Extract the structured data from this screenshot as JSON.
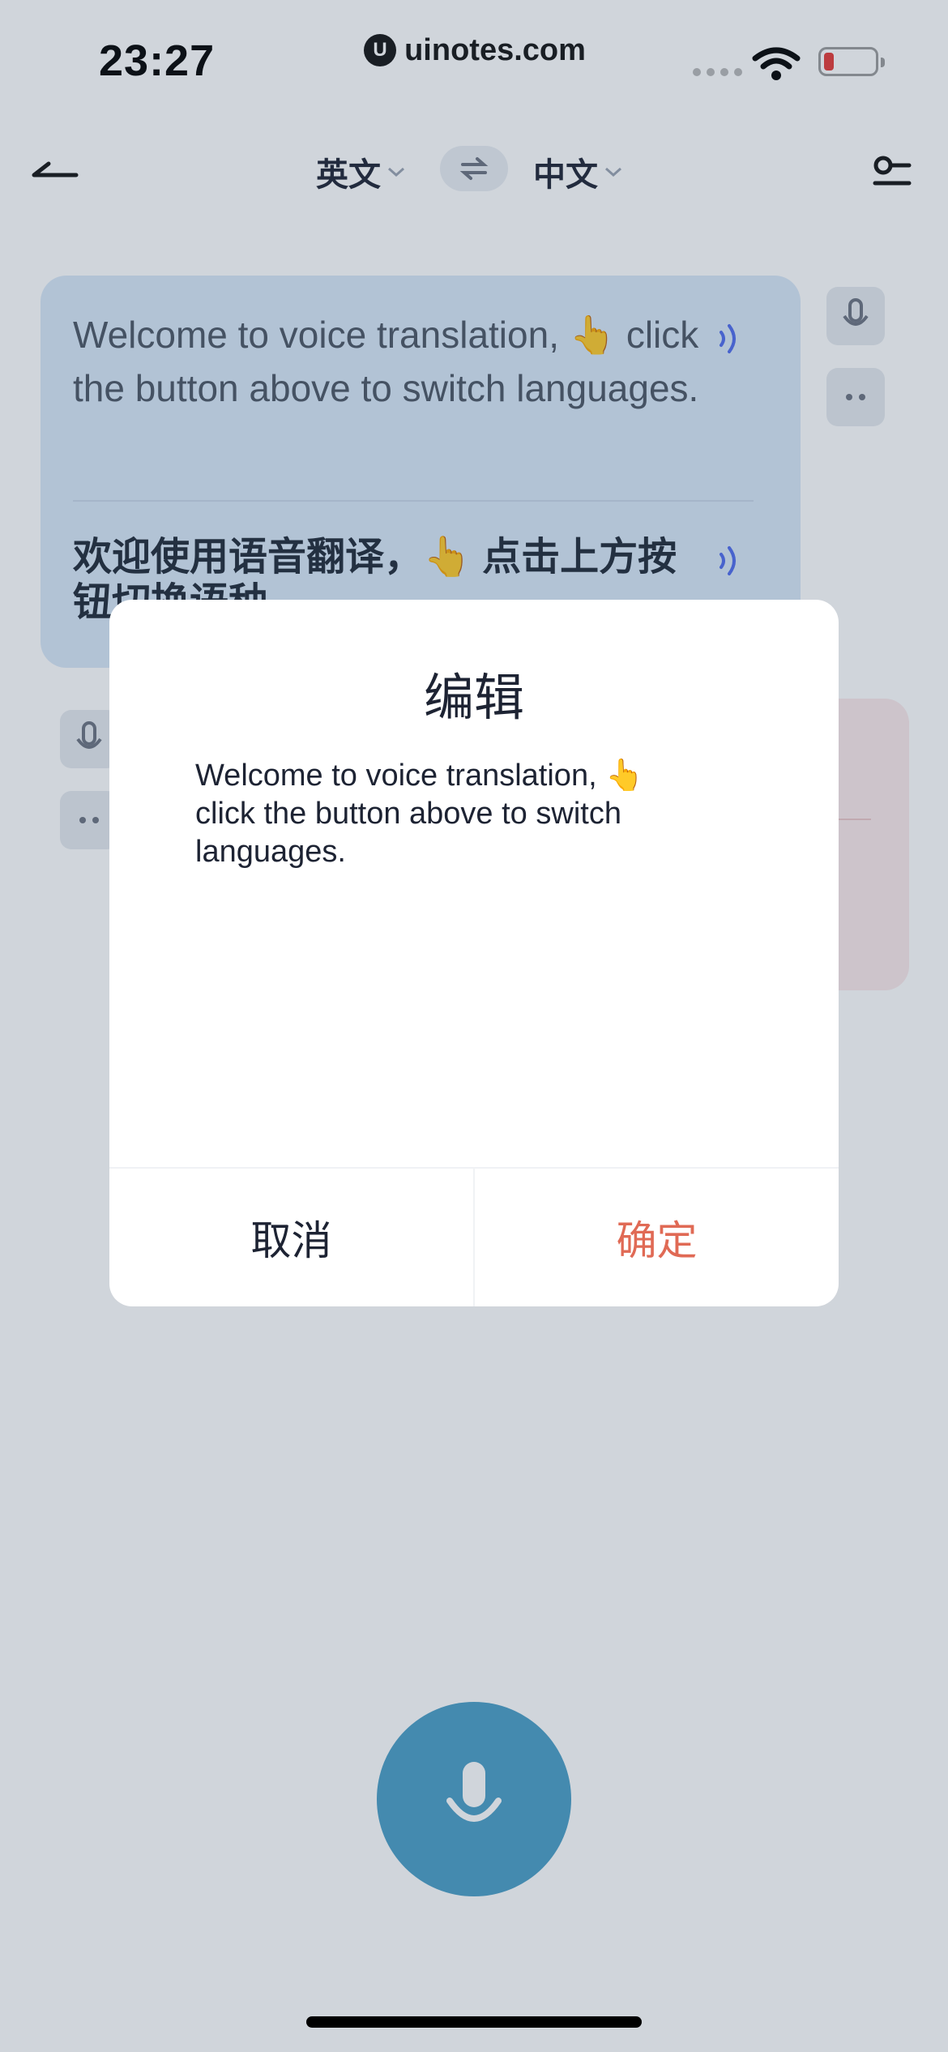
{
  "status_bar": {
    "time": "23:27"
  },
  "watermark": {
    "text": "uinotes.com"
  },
  "nav": {
    "source_lang": "英文",
    "target_lang": "中文"
  },
  "card": {
    "english_text": "Welcome to  voice translation, 👆 click the button above to switch languages.",
    "chinese_text": "欢迎使用语音翻译，👆 点击上方按钮切换语种"
  },
  "dialog": {
    "title": "编辑",
    "text": "Welcome to  voice translation, 👆\nclick the button above to switch\nlanguages.",
    "cancel_label": "取消",
    "ok_label": "确定"
  },
  "colors": {
    "accent_blue": "#4a9ec6",
    "confirm_red": "#e06a55",
    "card_blue": "#d9e8f8",
    "speaker_blue": "#4f6bed"
  }
}
